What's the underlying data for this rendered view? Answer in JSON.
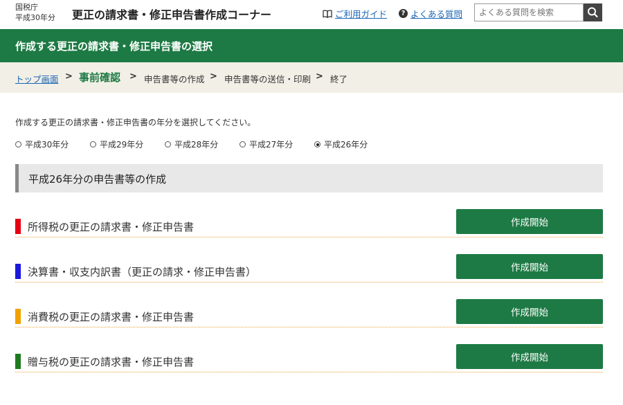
{
  "header": {
    "agency": "国税庁",
    "year_label": "平成30年分",
    "app_title": "更正の請求書・修正申告書作成コーナー",
    "guide_link": "ご利用ガイド",
    "faq_link": "よくある質問",
    "search_placeholder": "よくある質問を検索",
    "icons": {
      "guide": "book-icon",
      "faq": "question-circle-icon",
      "search": "search-icon"
    }
  },
  "band": {
    "title": "作成する更正の請求書・修正申告書の選択"
  },
  "breadcrumb": {
    "items": [
      "トップ画面",
      "事前確認",
      "申告書等の作成",
      "申告書等の送信・印刷",
      "終了"
    ],
    "current_index": 1,
    "separator": ">"
  },
  "main": {
    "prompt": "作成する更正の請求書・修正申告書の年分を選択してください。",
    "years": [
      {
        "label": "平成30年分",
        "selected": false
      },
      {
        "label": "平成29年分",
        "selected": false
      },
      {
        "label": "平成28年分",
        "selected": false
      },
      {
        "label": "平成27年分",
        "selected": false
      },
      {
        "label": "平成26年分",
        "selected": true
      }
    ],
    "section_heading": "平成26年分の申告書等の作成",
    "forms": [
      {
        "label": "所得税の更正の請求書・修正申告書",
        "color": "#e60012",
        "button": "作成開始"
      },
      {
        "label": "決算書・収支内訳書（更正の請求・修正申告書）",
        "color": "#1a1adc",
        "button": "作成開始"
      },
      {
        "label": "消費税の更正の請求書・修正申告書",
        "color": "#f2a200",
        "button": "作成開始"
      },
      {
        "label": "贈与税の更正の請求書・修正申告書",
        "color": "#1e7a1e",
        "button": "作成開始"
      }
    ]
  },
  "colors": {
    "brand_green": "#1d7a44",
    "link_blue": "#1a64b4",
    "breadcrumb_bg": "#f2efe6"
  }
}
